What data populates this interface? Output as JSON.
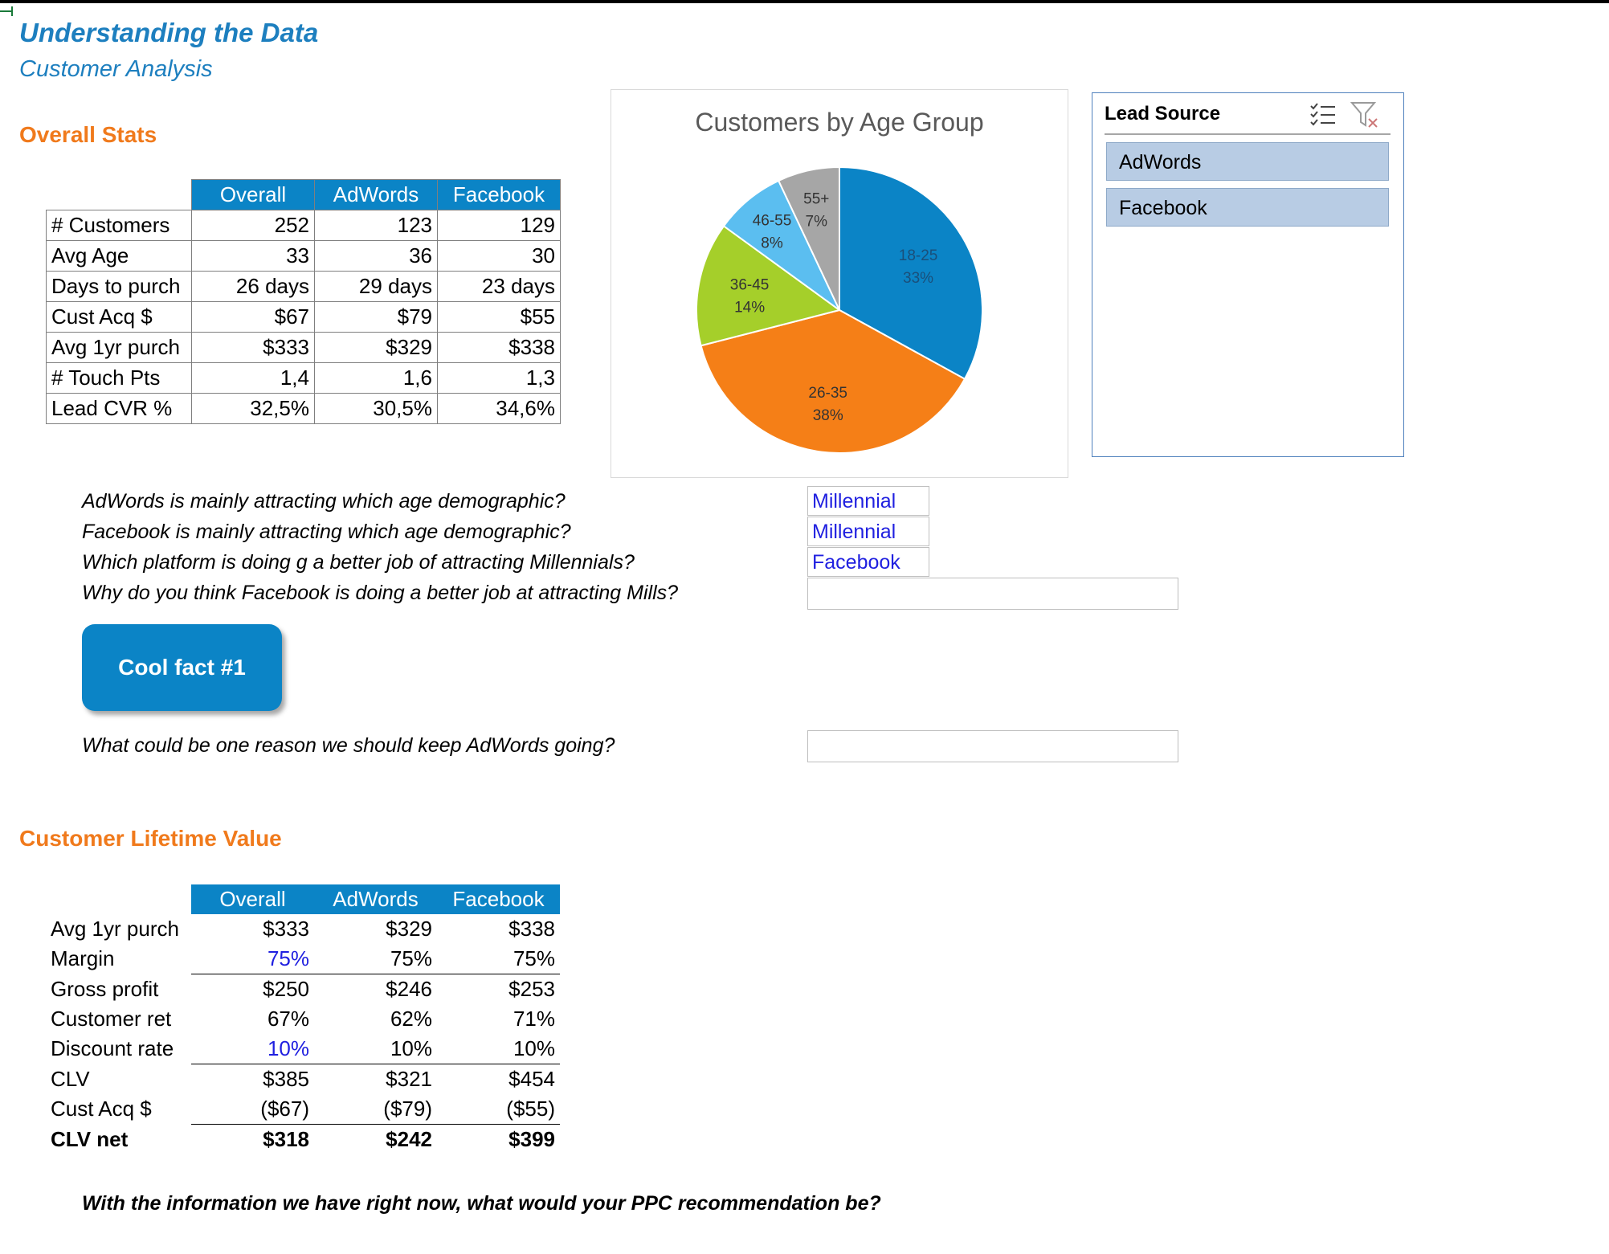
{
  "header": {
    "title": "Understanding the Data",
    "subtitle": "Customer Analysis"
  },
  "overall_stats": {
    "heading": "Overall Stats",
    "columns": [
      "Overall",
      "AdWords",
      "Facebook"
    ],
    "rows": [
      {
        "label": "# Customers",
        "values": [
          "252",
          "123",
          "129"
        ]
      },
      {
        "label": "Avg Age",
        "values": [
          "33",
          "36",
          "30"
        ]
      },
      {
        "label": "Days to purch",
        "values": [
          "26 days",
          "29 days",
          "23 days"
        ]
      },
      {
        "label": "Cust Acq $",
        "values": [
          "$67",
          "$79",
          "$55"
        ]
      },
      {
        "label": "Avg 1yr purch",
        "values": [
          "$333",
          "$329",
          "$338"
        ]
      },
      {
        "label": "# Touch Pts",
        "values": [
          "1,4",
          "1,6",
          "1,3"
        ]
      },
      {
        "label": "Lead CVR %",
        "values": [
          "32,5%",
          "30,5%",
          "34,6%"
        ]
      }
    ]
  },
  "chart_data": {
    "type": "pie",
    "title": "Customers by Age Group",
    "categories": [
      "18-25",
      "26-35",
      "36-45",
      "46-55",
      "55+"
    ],
    "values": [
      33,
      38,
      14,
      8,
      7
    ],
    "labels": [
      "33%",
      "38%",
      "14%",
      "8%",
      "7%"
    ],
    "colors": [
      "#0b84c6",
      "#f57f17",
      "#a5cf2a",
      "#5bbef0",
      "#a6a6a6"
    ],
    "legend": "none"
  },
  "slicer": {
    "title": "Lead Source",
    "items": [
      "AdWords",
      "Facebook"
    ],
    "icons": [
      "multi-select-icon",
      "clear-filter-icon"
    ]
  },
  "questions": [
    {
      "text": "AdWords is mainly attracting which age demographic?",
      "answer": "Millennial"
    },
    {
      "text": "Facebook is mainly attracting which age demographic?",
      "answer": "Millennial"
    },
    {
      "text": "Which platform is doing g a better job of attracting Millennials?",
      "answer": "Facebook"
    },
    {
      "text": "Why do you think Facebook is doing a better job at attracting Mills?",
      "answer": ""
    }
  ],
  "cool_fact": {
    "label": "Cool fact #1"
  },
  "question_adwords": {
    "text": "What could be one reason we should keep AdWords going?",
    "answer": ""
  },
  "clv": {
    "heading": "Customer Lifetime Value",
    "columns": [
      "Overall",
      "AdWords",
      "Facebook"
    ],
    "rows": [
      {
        "label": "Avg 1yr purch",
        "values": [
          "$333",
          "$329",
          "$338"
        ]
      },
      {
        "label": "Margin",
        "values": [
          "75%",
          "75%",
          "75%"
        ]
      },
      {
        "label": "Gross profit",
        "values": [
          "$250",
          "$246",
          "$253"
        ]
      },
      {
        "label": "Customer ret",
        "values": [
          "67%",
          "62%",
          "71%"
        ]
      },
      {
        "label": "Discount rate",
        "values": [
          "10%",
          "10%",
          "10%"
        ]
      },
      {
        "label": "CLV",
        "values": [
          "$385",
          "$321",
          "$454"
        ]
      },
      {
        "label": "Cust Acq $",
        "values": [
          "($67)",
          "($79)",
          "($55)"
        ]
      },
      {
        "label": "CLV net",
        "values": [
          "$318",
          "$242",
          "$399"
        ]
      }
    ]
  },
  "final_question": "With the information we have right now, what would your PPC recommendation be?",
  "colors": {
    "accent_blue": "#0b84c6",
    "title_blue": "#1d7fbf",
    "section_orange": "#f07a1c",
    "input_blue": "#2020e0",
    "slicer_item": "#b8cce4"
  }
}
